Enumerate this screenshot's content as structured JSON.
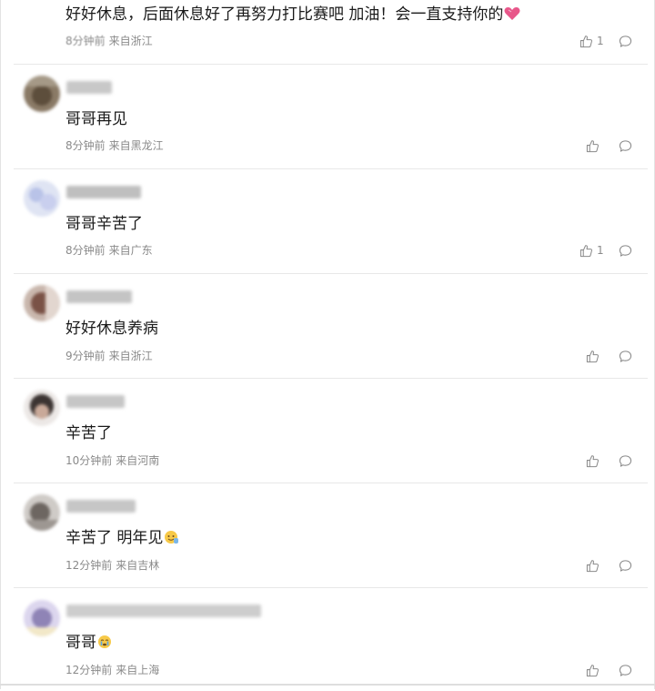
{
  "comments": [
    {
      "text": "好好休息，后面休息好了再努力打比赛吧 加油！会一直支持你的",
      "time": "8分钟前",
      "location": "来自浙江",
      "likes": "1",
      "emoji": "heart-icon"
    },
    {
      "text": "哥哥再见",
      "time": "8分钟前",
      "location": "来自黑龙江",
      "likes": ""
    },
    {
      "text": "哥哥辛苦了",
      "time": "8分钟前",
      "location": "来自广东",
      "likes": "1"
    },
    {
      "text": "好好休息养病",
      "time": "9分钟前",
      "location": "来自浙江",
      "likes": ""
    },
    {
      "text": "辛苦了",
      "time": "10分钟前",
      "location": "来自河南",
      "likes": ""
    },
    {
      "text": "辛苦了 明年见",
      "time": "12分钟前",
      "location": "来自吉林",
      "likes": "",
      "emoji": "waving-emoji-icon"
    },
    {
      "text": "哥哥",
      "time": "12分钟前",
      "location": "来自上海",
      "likes": "",
      "emoji": "crying-emoji-icon"
    }
  ],
  "colors": {
    "text": "#1a1a1a",
    "meta": "#8a8a8a",
    "divider": "#e8e8e8"
  }
}
